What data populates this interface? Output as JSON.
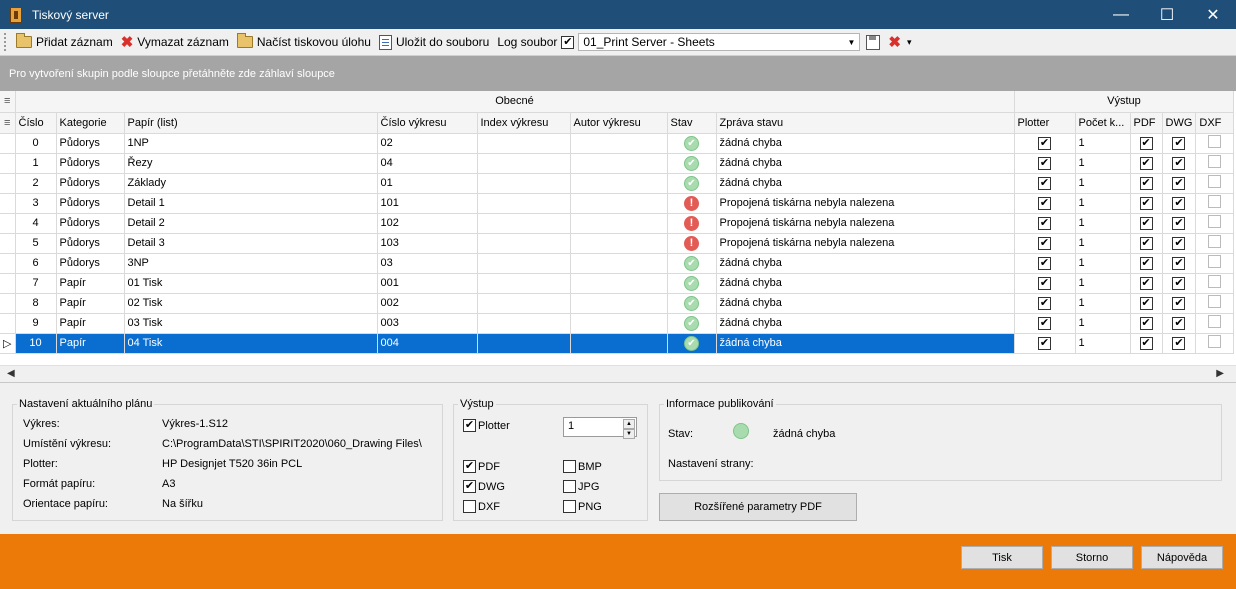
{
  "window": {
    "title": "Tiskový server"
  },
  "toolbar": {
    "add_label": "Přidat záznam",
    "delete_label": "Vymazat záznam",
    "load_label": "Načíst tiskovou úlohu",
    "save_label": "Uložit do souboru",
    "log_label": "Log soubor",
    "log_enabled": true,
    "log_value": "01_Print Server - Sheets"
  },
  "group_hint": "Pro vytvoření skupin podle sloupce přetáhněte zde záhlaví sloupce",
  "grid": {
    "bands": {
      "general": "Obecné",
      "output": "Výstup"
    },
    "columns": [
      "Číslo",
      "Kategorie",
      "Papír (list)",
      "Číslo výkresu",
      "Index výkresu",
      "Autor výkresu",
      "Stav",
      "Zpráva stavu",
      "Plotter",
      "Počet k...",
      "PDF",
      "DWG",
      "DXF"
    ],
    "rows": [
      {
        "num": "0",
        "cat": "Půdorys",
        "sheet": "1NP",
        "dwgno": "02",
        "index": "",
        "author": "",
        "status": "ok",
        "msg": "žádná chyba",
        "plotter": true,
        "count": "1",
        "pdf": true,
        "dwg": true,
        "dxf": false
      },
      {
        "num": "1",
        "cat": "Půdorys",
        "sheet": "Řezy",
        "dwgno": "04",
        "index": "",
        "author": "",
        "status": "ok",
        "msg": "žádná chyba",
        "plotter": true,
        "count": "1",
        "pdf": true,
        "dwg": true,
        "dxf": false
      },
      {
        "num": "2",
        "cat": "Půdorys",
        "sheet": "Základy",
        "dwgno": "01",
        "index": "",
        "author": "",
        "status": "ok",
        "msg": "žádná chyba",
        "plotter": true,
        "count": "1",
        "pdf": true,
        "dwg": true,
        "dxf": false
      },
      {
        "num": "3",
        "cat": "Půdorys",
        "sheet": "Detail 1",
        "dwgno": "101",
        "index": "",
        "author": "",
        "status": "error",
        "msg": "Propojená tiskárna nebyla nalezena",
        "plotter": true,
        "count": "1",
        "pdf": true,
        "dwg": true,
        "dxf": false
      },
      {
        "num": "4",
        "cat": "Půdorys",
        "sheet": "Detail 2",
        "dwgno": "102",
        "index": "",
        "author": "",
        "status": "error",
        "msg": "Propojená tiskárna nebyla nalezena",
        "plotter": true,
        "count": "1",
        "pdf": true,
        "dwg": true,
        "dxf": false
      },
      {
        "num": "5",
        "cat": "Půdorys",
        "sheet": "Detail 3",
        "dwgno": "103",
        "index": "",
        "author": "",
        "status": "error",
        "msg": "Propojená tiskárna nebyla nalezena",
        "plotter": true,
        "count": "1",
        "pdf": true,
        "dwg": true,
        "dxf": false
      },
      {
        "num": "6",
        "cat": "Půdorys",
        "sheet": "3NP",
        "dwgno": "03",
        "index": "",
        "author": "",
        "status": "ok",
        "msg": "žádná chyba",
        "plotter": true,
        "count": "1",
        "pdf": true,
        "dwg": true,
        "dxf": false
      },
      {
        "num": "7",
        "cat": "Papír",
        "sheet": "01 Tisk",
        "dwgno": "001",
        "index": "",
        "author": "",
        "status": "ok",
        "msg": "žádná chyba",
        "plotter": true,
        "count": "1",
        "pdf": true,
        "dwg": true,
        "dxf": false
      },
      {
        "num": "8",
        "cat": "Papír",
        "sheet": "02 Tisk",
        "dwgno": "002",
        "index": "",
        "author": "",
        "status": "ok",
        "msg": "žádná chyba",
        "plotter": true,
        "count": "1",
        "pdf": true,
        "dwg": true,
        "dxf": false
      },
      {
        "num": "9",
        "cat": "Papír",
        "sheet": "03 Tisk",
        "dwgno": "003",
        "index": "",
        "author": "",
        "status": "ok",
        "msg": "žádná chyba",
        "plotter": true,
        "count": "1",
        "pdf": true,
        "dwg": true,
        "dxf": false
      },
      {
        "num": "10",
        "cat": "Papír",
        "sheet": "04 Tisk",
        "dwgno": "004",
        "index": "",
        "author": "",
        "status": "ok",
        "msg": "žádná chyba",
        "plotter": true,
        "count": "1",
        "pdf": true,
        "dwg": true,
        "dxf": false,
        "selected": true
      }
    ]
  },
  "current_plan": {
    "legend": "Nastavení aktuálního plánu",
    "fields": [
      {
        "label": "Výkres:",
        "value": "Výkres-1.S12"
      },
      {
        "label": "Umístění výkresu:",
        "value": "C:\\ProgramData\\STI\\SPIRIT2020\\060_Drawing Files\\"
      },
      {
        "label": "Plotter:",
        "value": "HP Designjet T520 36in PCL"
      },
      {
        "label": "Formát papíru:",
        "value": "A3"
      },
      {
        "label": "Orientace papíru:",
        "value": "Na šířku"
      }
    ]
  },
  "output": {
    "legend": "Výstup",
    "plotter_label": "Plotter",
    "plotter": true,
    "copies": "1",
    "pdf_label": "PDF",
    "pdf": true,
    "dwg_label": "DWG",
    "dwg": true,
    "dxf_label": "DXF",
    "dxf": false,
    "bmp_label": "BMP",
    "bmp": false,
    "jpg_label": "JPG",
    "jpg": false,
    "png_label": "PNG",
    "png": false
  },
  "publish": {
    "legend": "Informace publikování",
    "status_label": "Stav:",
    "status_value": "žádná chyba",
    "page_label": "Nastavení strany:",
    "pdf_button": "Rozšířené parametry PDF"
  },
  "footer": {
    "print": "Tisk",
    "cancel": "Storno",
    "help": "Nápověda"
  },
  "colors": {
    "titlebar": "#1f4f78",
    "footer": "#ec7a08",
    "selection": "#0a6ed1"
  }
}
